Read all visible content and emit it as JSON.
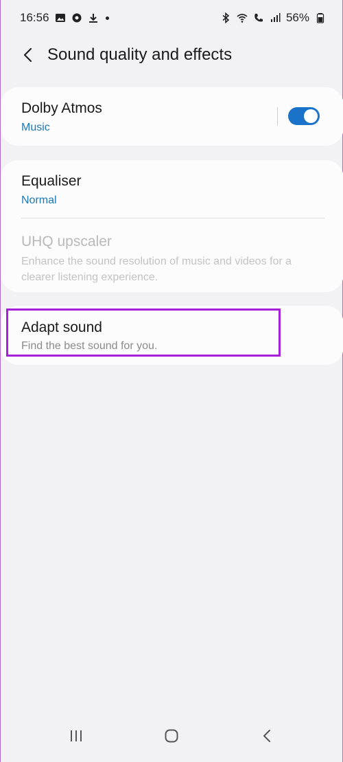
{
  "status_bar": {
    "time": "16:56",
    "battery": "56%",
    "icons": [
      "gallery-icon",
      "record-icon",
      "download-icon",
      "bluetooth-icon",
      "wifi-icon",
      "call-icon",
      "signal-icon",
      "battery-icon"
    ]
  },
  "header": {
    "title": "Sound quality and effects"
  },
  "settings": {
    "dolby": {
      "title": "Dolby Atmos",
      "subtitle": "Music",
      "enabled": true
    },
    "equaliser": {
      "title": "Equaliser",
      "value": "Normal"
    },
    "uhq": {
      "title": "UHQ upscaler",
      "description": "Enhance the sound resolution of music and videos for a clearer listening experience."
    },
    "adapt": {
      "title": "Adapt sound",
      "description": "Find the best sound for you."
    }
  },
  "colors": {
    "accent": "#1b78b4",
    "toggle": "#1a73c9",
    "highlight": "#a51fdc",
    "background": "#f2f2f5",
    "card": "#fcfcfc"
  }
}
